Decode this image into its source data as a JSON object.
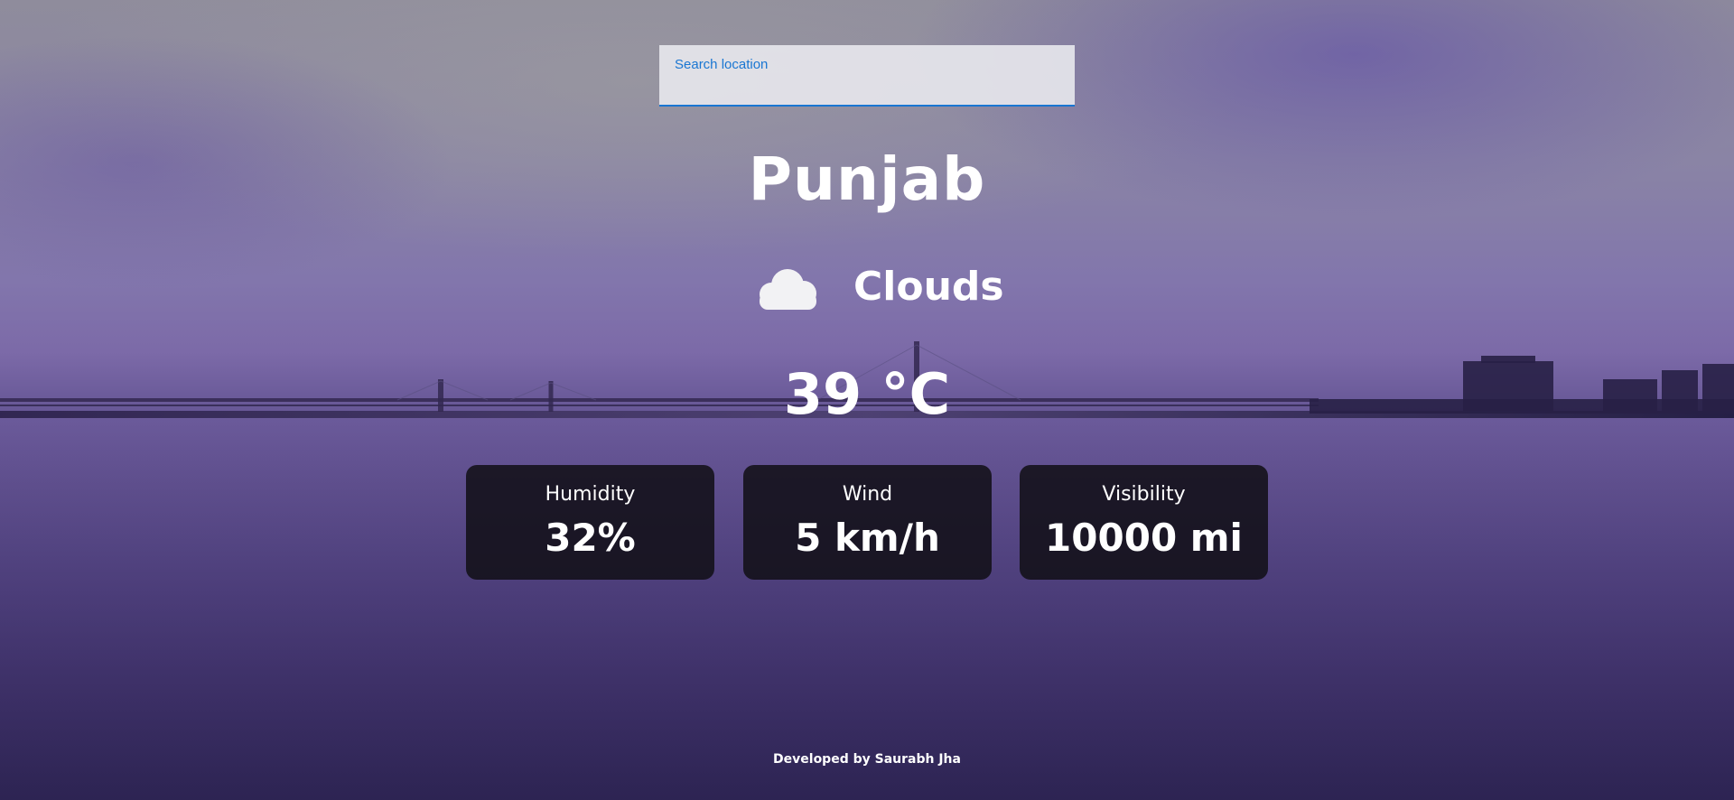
{
  "search": {
    "placeholder": "Search location"
  },
  "weather": {
    "city": "Punjab",
    "condition": "Clouds",
    "condition_icon": "cloud-icon",
    "temperature": "39 °C"
  },
  "stats": [
    {
      "label": "Humidity",
      "value": "32%"
    },
    {
      "label": "Wind",
      "value": "5 km/h"
    },
    {
      "label": "Visibility",
      "value": "10000 mi"
    }
  ],
  "footer": {
    "credit": "Developed by Saurabh Jha"
  },
  "colors": {
    "accent": "#1976d2",
    "card_bg": "#121018",
    "text": "#ffffff"
  }
}
